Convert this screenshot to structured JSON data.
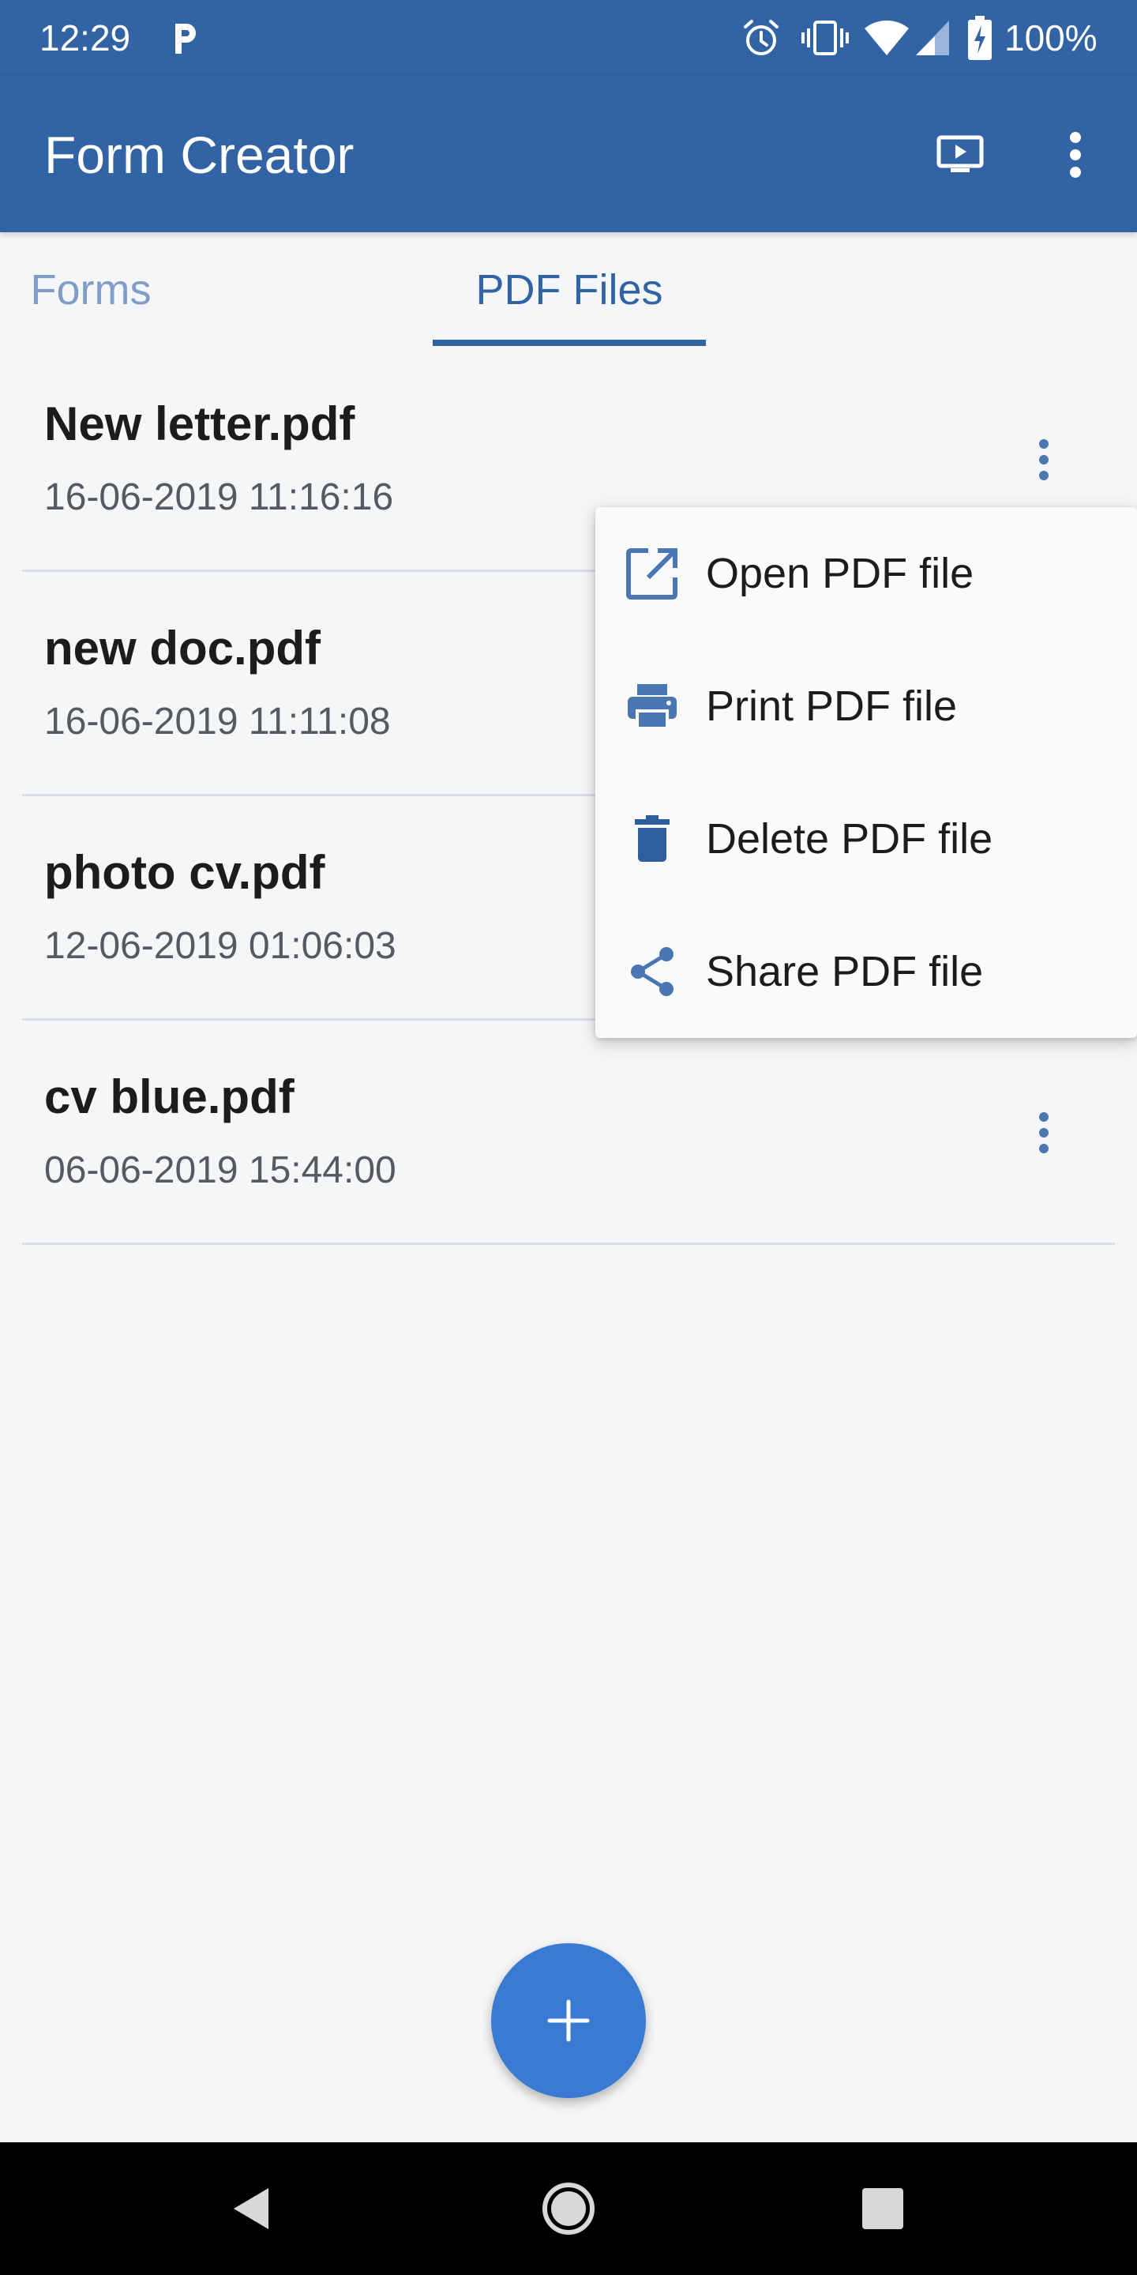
{
  "status_bar": {
    "time": "12:29",
    "battery": "100%",
    "icons": [
      "parking-icon",
      "alarm-icon",
      "vibrate-icon",
      "wifi-icon",
      "signal-icon",
      "battery-charging-icon"
    ]
  },
  "app_bar": {
    "title": "Form Creator",
    "actions": [
      "slideshow-icon",
      "more-vert-icon"
    ]
  },
  "tabs": [
    {
      "label": "Forms",
      "selected": false
    },
    {
      "label": "PDF Files",
      "selected": true
    }
  ],
  "files": [
    {
      "name": "New letter.pdf",
      "date": "16-06-2019 11:16:16"
    },
    {
      "name": "new doc.pdf",
      "date": "16-06-2019 11:11:08"
    },
    {
      "name": "photo cv.pdf",
      "date": "12-06-2019 01:06:03"
    },
    {
      "name": "cv blue.pdf",
      "date": "06-06-2019 15:44:00"
    }
  ],
  "popup_menu": {
    "items": [
      {
        "label": "Open PDF file",
        "icon": "open-external-icon"
      },
      {
        "label": "Print PDF file",
        "icon": "print-icon"
      },
      {
        "label": "Delete PDF file",
        "icon": "delete-icon"
      },
      {
        "label": "Share PDF file",
        "icon": "share-icon"
      }
    ]
  },
  "fab": {
    "icon": "plus-icon"
  },
  "nav_bar": {
    "buttons": [
      "back-icon",
      "home-icon",
      "recents-icon"
    ]
  },
  "colors": {
    "primary": "#3163a5",
    "fab": "#3b7ad3",
    "background": "#f5f6f8",
    "tab_inactive": "#7f9dc6"
  }
}
